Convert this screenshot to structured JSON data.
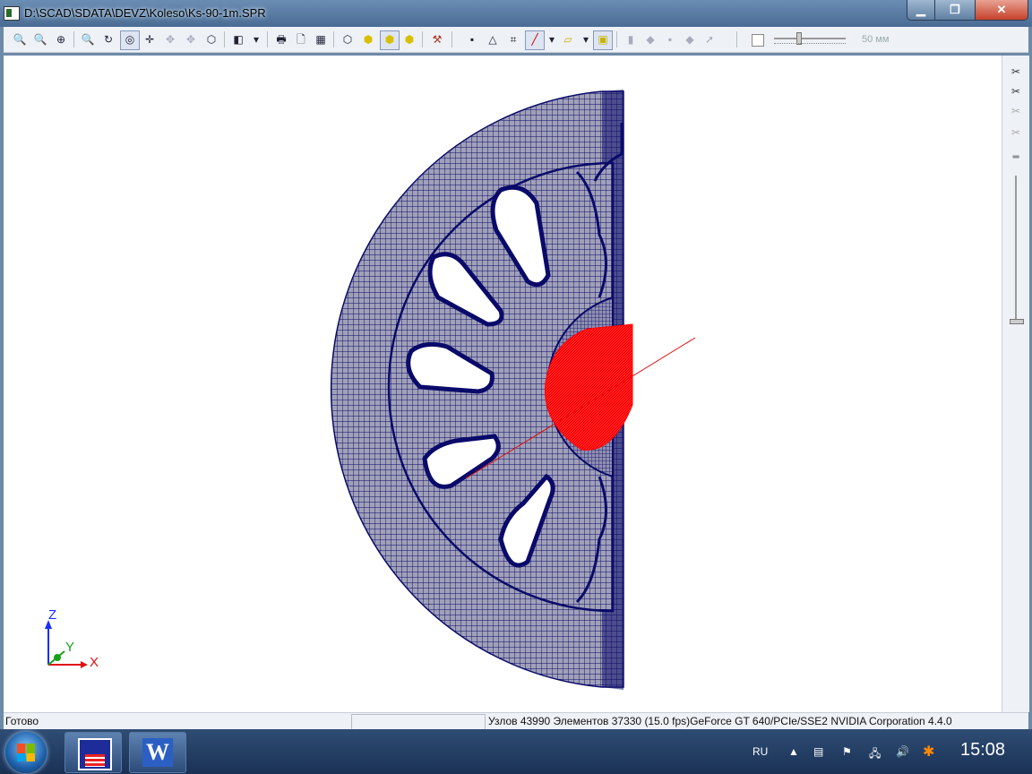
{
  "window": {
    "title": "D:\\SCAD\\SDATA\\DEVZ\\Koleso\\Ks-90-1m.SPR"
  },
  "toolbar": {
    "distance_label": "50 мм"
  },
  "axes": {
    "z": "Z",
    "y": "Y",
    "x": "X"
  },
  "status": {
    "ready": "Готово",
    "info": "Узлов 43990  Элементов 37330  (15.0 fps)GeForce GT 640/PCIe/SSE2 NVIDIA Corporation 4.4.0"
  },
  "taskbar": {
    "language": "RU",
    "clock": "15:08",
    "word_letter": "W"
  },
  "colors": {
    "mesh_fill": "#a0a0b8",
    "mesh_line": "#0a0a6a",
    "highlight": "#ff0000",
    "axis_blue": "#1a2cff",
    "axis_red": "#e01010",
    "axis_green": "#17a017"
  }
}
